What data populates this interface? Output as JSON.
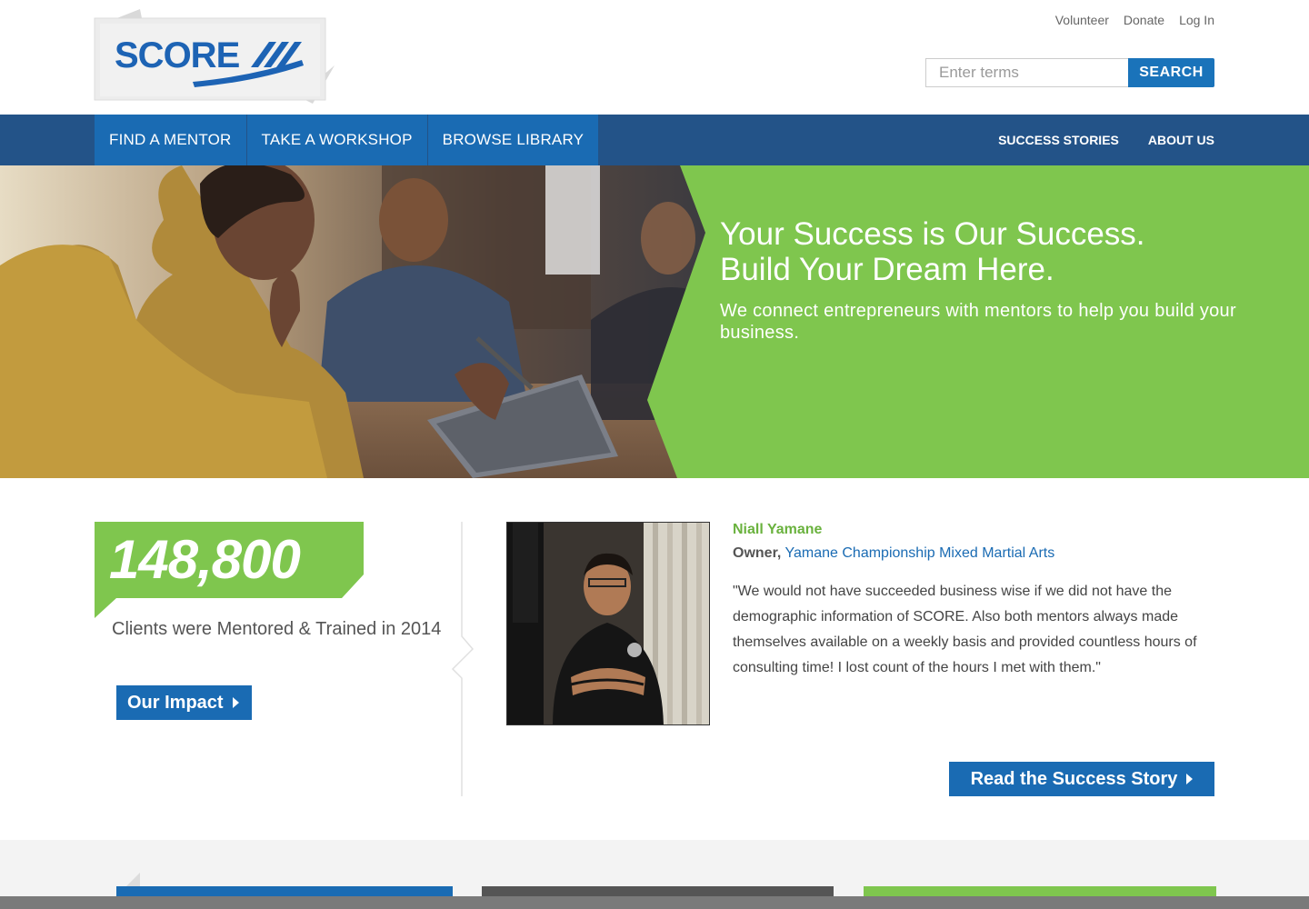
{
  "header": {
    "logo_text": "SCORE",
    "util_links": [
      "Volunteer",
      "Donate",
      "Log In"
    ],
    "search": {
      "placeholder": "Enter terms",
      "button_label": "SEARCH"
    }
  },
  "nav": {
    "primary": [
      "FIND A MENTOR",
      "TAKE A WORKSHOP",
      "BROWSE LIBRARY"
    ],
    "secondary": [
      "SUCCESS STORIES",
      "ABOUT US"
    ]
  },
  "hero": {
    "title_line1": "Your Success is Our Success.",
    "title_line2": "Build Your Dream Here.",
    "subtitle": "We connect entrepreneurs with mentors to help you build your business."
  },
  "impact": {
    "number": "148,800",
    "text": "Clients were Mentored & Trained in 2014",
    "button_label": "Our Impact"
  },
  "testimonial": {
    "name": "Niall Yamane",
    "role": "Owner,",
    "company": "Yamane Championship Mixed Martial Arts",
    "quote": "\"We would not have succeeded business wise if we did not have the demographic information of SCORE. Also both mentors always made themselves available on a weekly basis and provided countless hours of consulting time! I lost count of the hours I met with them.\"",
    "button_label": "Read the Success Story"
  },
  "colors": {
    "brand_blue": "#1a6bb3",
    "nav_blue": "#235388",
    "brand_green": "#7fc64e",
    "name_green": "#6ab23e"
  }
}
